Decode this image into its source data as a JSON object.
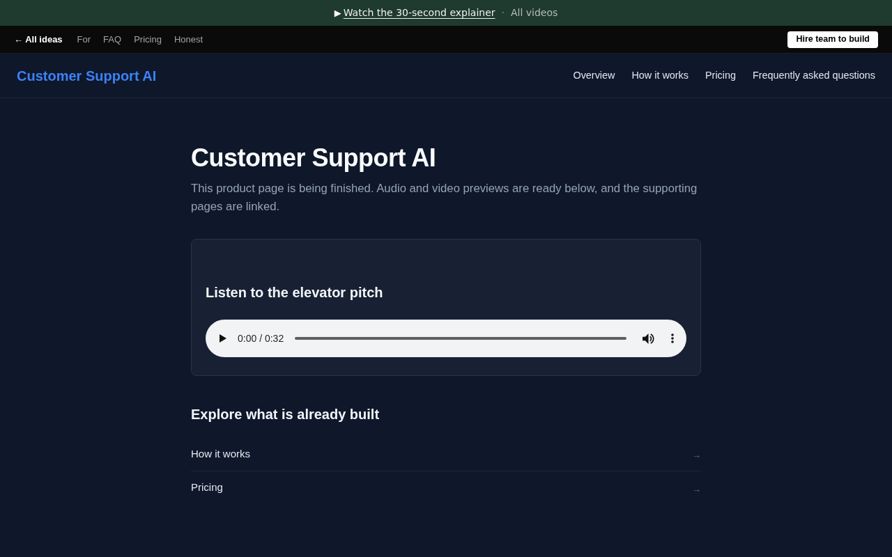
{
  "banner": {
    "play_glyph": "▶",
    "link": "Watch the 30-second explainer",
    "separator": "·",
    "secondary_link": "All videos"
  },
  "top_nav": {
    "back_link": "← All ideas",
    "links": [
      "For",
      "FAQ",
      "Pricing",
      "Honest"
    ],
    "cta": "Hire team to build"
  },
  "header": {
    "logo": "Customer Support AI",
    "nav": [
      "Overview",
      "How it works",
      "Pricing",
      "Frequently asked questions"
    ]
  },
  "hero": {
    "title": "Customer Support AI",
    "description": "This product page is being finished. Audio and video previews are ready below, and the supporting pages are linked."
  },
  "audio_card": {
    "title": "Listen to the elevator pitch",
    "player": {
      "time": "0:00 / 0:32"
    }
  },
  "explore": {
    "title": "Explore what is already built",
    "links": [
      {
        "label": "How it works",
        "arrow": "→"
      },
      {
        "label": "Pricing",
        "arrow": "→"
      }
    ]
  }
}
